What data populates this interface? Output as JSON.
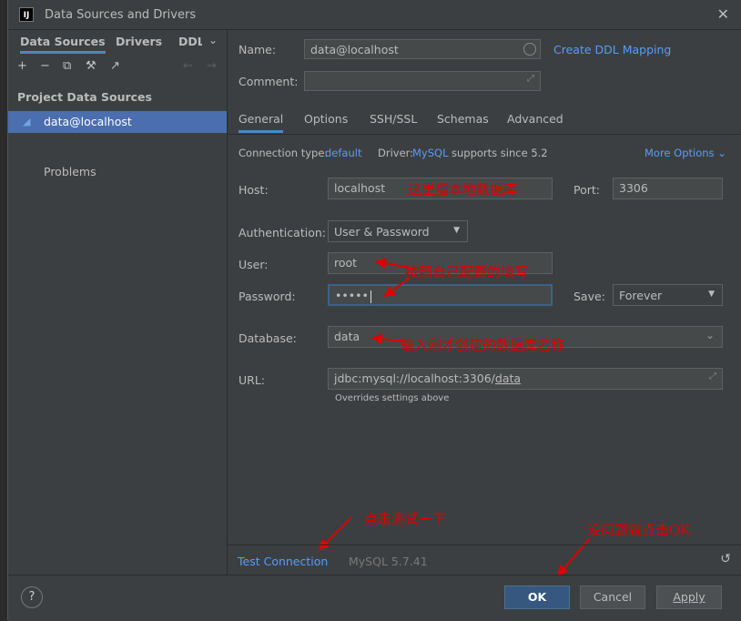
{
  "window": {
    "title": "Data Sources and Drivers",
    "app_icon": "IJ"
  },
  "sidebar": {
    "tabs": [
      "Data Sources",
      "Drivers",
      "DDL"
    ],
    "section_title": "Project Data Sources",
    "items": [
      {
        "label": "data@localhost"
      }
    ],
    "problems_label": "Problems"
  },
  "form": {
    "name_label": "Name:",
    "name_value": "data@localhost",
    "create_ddl": "Create DDL Mapping",
    "comment_label": "Comment:",
    "tabs": [
      "General",
      "Options",
      "SSH/SSL",
      "Schemas",
      "Advanced"
    ],
    "conn_type_label": "Connection type:",
    "conn_type_value": "default",
    "driver_label": "Driver:",
    "driver_value": "MySQL",
    "driver_suffix": "supports since 5.2",
    "more_options": "More Options",
    "host_label": "Host:",
    "host_value": "localhost",
    "port_label": "Port:",
    "port_value": "3306",
    "auth_label": "Authentication:",
    "auth_value": "User & Password",
    "user_label": "User:",
    "user_value": "root",
    "password_label": "Password:",
    "password_value": "•••••",
    "save_label": "Save:",
    "save_value": "Forever",
    "database_label": "Database:",
    "database_value": "data",
    "url_label": "URL:",
    "url_prefix": "jdbc:mysql://localhost:3306/",
    "url_db": "data",
    "url_hint": "Overrides settings above",
    "test_connection": "Test Connection",
    "server_version": "MySQL 5.7.41"
  },
  "annotations": {
    "host_note": "这里指本地数据库",
    "user_note": "按照自己配置的填写",
    "db_note": "输入刚才创建的数据库名称",
    "test_note": "点击测试一下",
    "ok_note": "没问题就点击OK"
  },
  "footer": {
    "help": "?",
    "ok": "OK",
    "cancel": "Cancel",
    "apply": "Apply"
  },
  "colors": {
    "accent": "#4a88c7",
    "link": "#589df6",
    "annotation": "#e00000",
    "selection": "#4b6eaf"
  }
}
